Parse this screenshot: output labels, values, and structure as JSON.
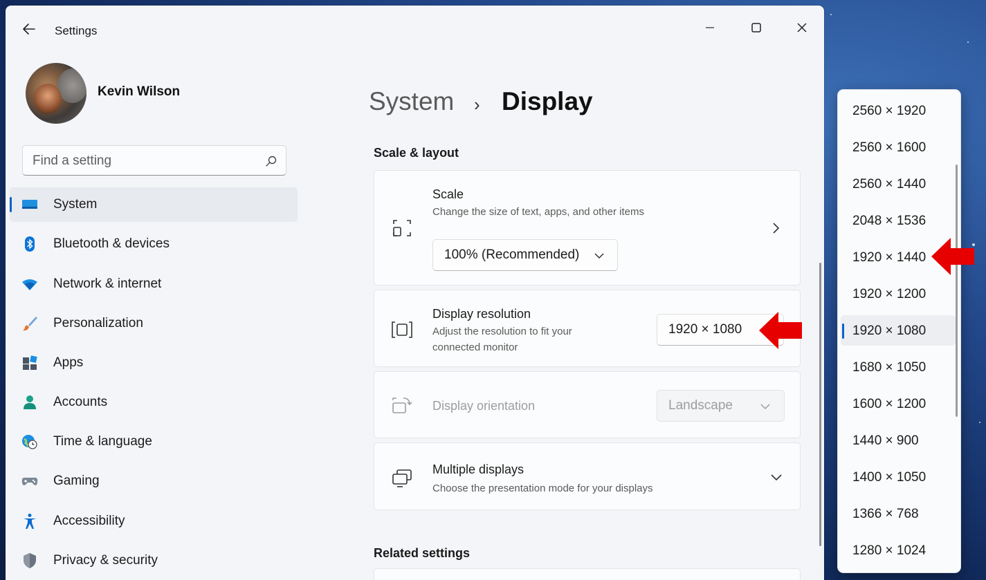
{
  "window": {
    "app_title": "Settings",
    "minimize_glyph": "—",
    "maximize_glyph": "☐",
    "close_glyph": "✕"
  },
  "profile": {
    "name": "Kevin Wilson"
  },
  "search": {
    "placeholder": "Find a setting"
  },
  "sidebar": {
    "items": [
      {
        "label": "System",
        "icon": "monitor-icon",
        "active": true
      },
      {
        "label": "Bluetooth & devices",
        "icon": "bluetooth-icon"
      },
      {
        "label": "Network & internet",
        "icon": "wifi-icon"
      },
      {
        "label": "Personalization",
        "icon": "brush-icon"
      },
      {
        "label": "Apps",
        "icon": "apps-icon"
      },
      {
        "label": "Accounts",
        "icon": "person-icon"
      },
      {
        "label": "Time & language",
        "icon": "globe-clock-icon"
      },
      {
        "label": "Gaming",
        "icon": "gamepad-icon"
      },
      {
        "label": "Accessibility",
        "icon": "accessibility-icon"
      },
      {
        "label": "Privacy & security",
        "icon": "shield-icon"
      }
    ]
  },
  "breadcrumb": {
    "parent": "System",
    "separator": "›",
    "current": "Display"
  },
  "sections": {
    "scale_layout": "Scale & layout",
    "related": "Related settings"
  },
  "cards": {
    "scale": {
      "title": "Scale",
      "subtitle": "Change the size of text, apps, and other items",
      "value": "100% (Recommended)"
    },
    "resolution": {
      "title": "Display resolution",
      "subtitle_line1": "Adjust the resolution to fit your",
      "subtitle_line2": "connected monitor",
      "value": "1920 × 1080"
    },
    "orientation": {
      "title": "Display orientation",
      "value": "Landscape",
      "disabled": true
    },
    "multiple": {
      "title": "Multiple displays",
      "subtitle": "Choose the presentation mode for your displays"
    }
  },
  "resolution_flyout": {
    "selected": "1920 × 1080",
    "options": [
      "2560 × 1920",
      "2560 × 1600",
      "2560 × 1440",
      "2048 × 1536",
      "1920 × 1440",
      "1920 × 1200",
      "1920 × 1080",
      "1680 × 1050",
      "1600 × 1200",
      "1440 × 900",
      "1400 × 1050",
      "1366 × 768",
      "1280 × 1024"
    ]
  },
  "colors": {
    "accent": "#0a62c9",
    "annotation_arrow": "#e60000"
  }
}
